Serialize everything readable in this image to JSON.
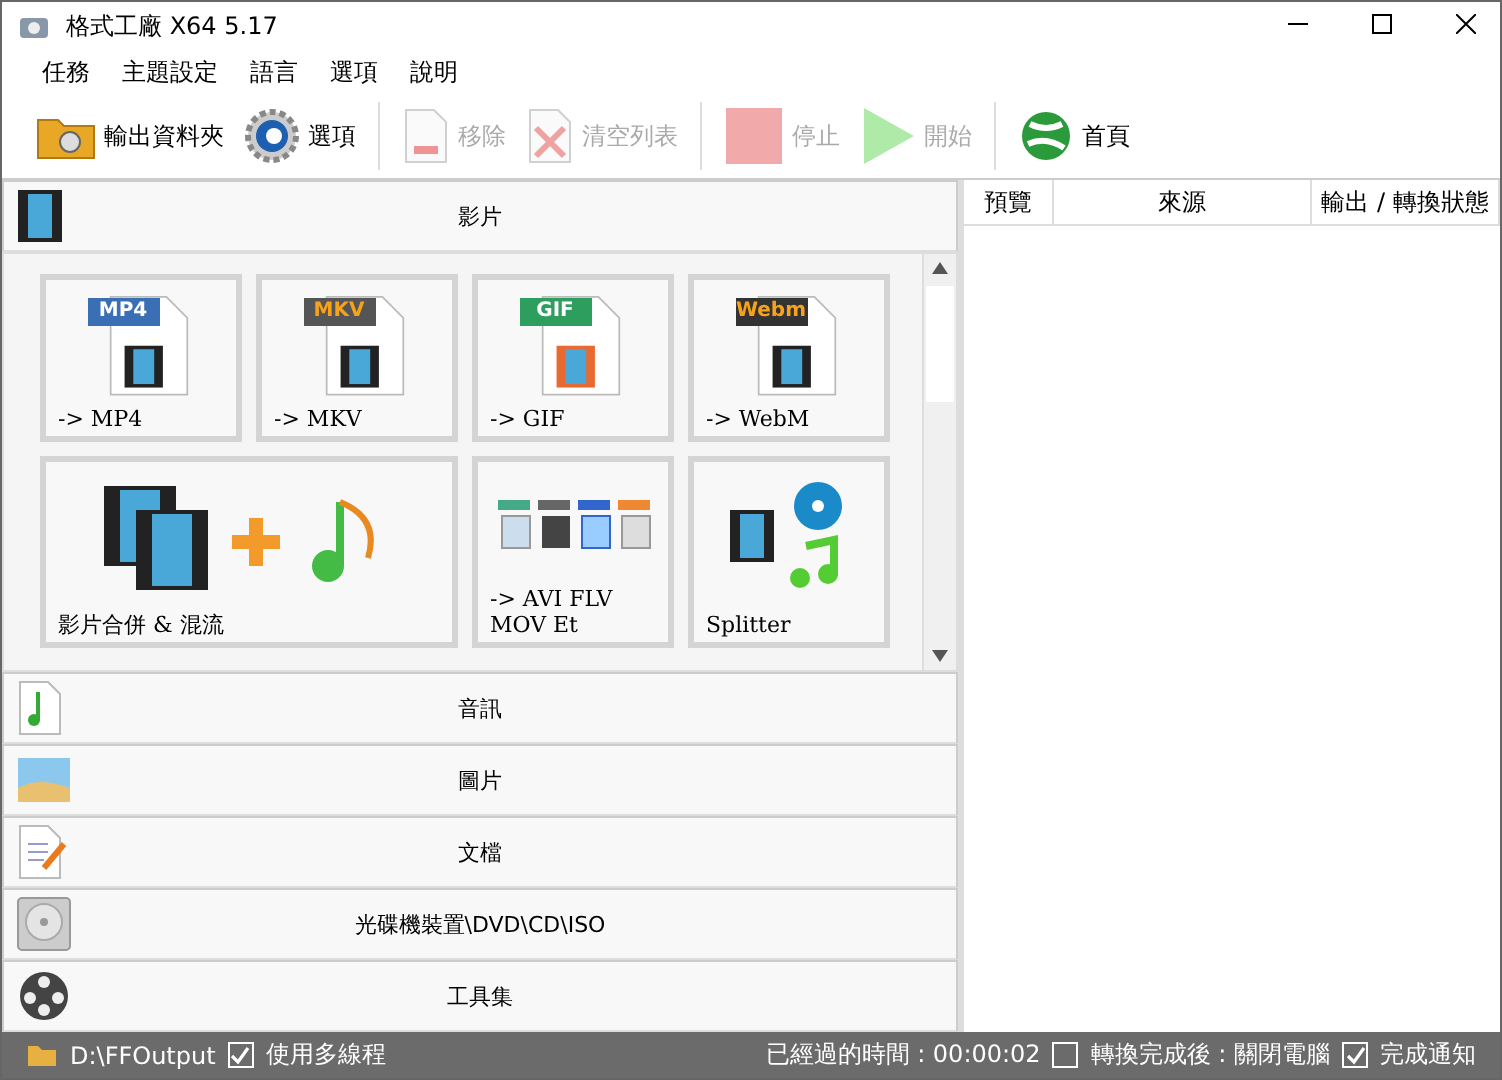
{
  "window": {
    "title": "格式工廠 X64 5.17"
  },
  "menu": [
    "任務",
    "主題設定",
    "語言",
    "選項",
    "說明"
  ],
  "toolbar": [
    {
      "kind": "folder",
      "label": "輸出資料夾",
      "disabled": false
    },
    {
      "kind": "gear",
      "label": "選項",
      "disabled": false
    },
    {
      "kind": "remove",
      "label": "移除",
      "disabled": true
    },
    {
      "kind": "clear",
      "label": "清空列表",
      "disabled": true
    },
    {
      "kind": "stop",
      "label": "停止",
      "disabled": true
    },
    {
      "kind": "start",
      "label": "開始",
      "disabled": true
    },
    {
      "kind": "globe",
      "label": "首頁",
      "disabled": false
    }
  ],
  "categories": [
    {
      "kind": "video",
      "label": "影片",
      "tiles": [
        {
          "kind": "doc",
          "badge": "MP4",
          "color": "#3b6fb5",
          "label": "-> MP4"
        },
        {
          "kind": "doc",
          "badge": "MKV",
          "color": "#555555",
          "label": "-> MKV"
        },
        {
          "kind": "doc",
          "badge": "GIF",
          "color": "#2e9e5e",
          "label": "-> GIF"
        },
        {
          "kind": "doc",
          "badge": "Webm",
          "color": "#333333",
          "label": "-> WebM"
        },
        {
          "kind": "merge",
          "label": "影片合併 & 混流",
          "wide": true
        },
        {
          "kind": "multi",
          "label": "-> AVI FLV MOV Et"
        },
        {
          "kind": "split",
          "label": "Splitter"
        }
      ]
    },
    {
      "kind": "audio",
      "label": "音訊"
    },
    {
      "kind": "picture",
      "label": "圖片"
    },
    {
      "kind": "document",
      "label": "文檔"
    },
    {
      "kind": "disc",
      "label": "光碟機裝置\\DVD\\CD\\ISO"
    },
    {
      "kind": "tools",
      "label": "工具集"
    }
  ],
  "task_table": {
    "columns": [
      "預覽",
      "來源",
      "輸出 / 轉換狀態"
    ]
  },
  "status_bar": {
    "output_path": "D:\\FFOutput",
    "options": [
      {
        "label": "使用多線程",
        "checked": true
      }
    ],
    "elapsed": "已經過的時間 : 00:00:02",
    "right_options": [
      {
        "label": "轉換完成後 : 關閉電腦",
        "checked": false
      },
      {
        "label": "完成通知",
        "checked": true
      }
    ]
  }
}
